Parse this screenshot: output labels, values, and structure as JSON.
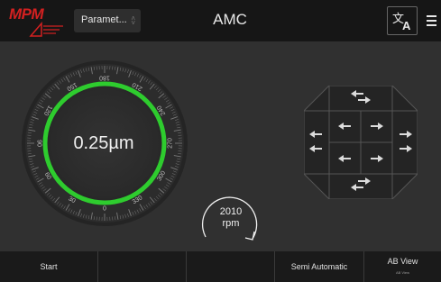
{
  "header": {
    "logo_text": "MPM",
    "parameter_select": "Paramet...",
    "title": "AMC",
    "translate_icon": "translate-icon",
    "menu_icon": "hamburger-menu-icon"
  },
  "gauge": {
    "readout": "0.25µm",
    "dial_labels": [
      "0",
      "30",
      "60",
      "90",
      "120",
      "150",
      "180",
      "210",
      "240",
      "270",
      "300",
      "330"
    ],
    "ring_color": "#2ecc2e"
  },
  "spindle": {
    "value": "2010",
    "unit": "rpm",
    "icon": "clockwise-arrow-icon"
  },
  "dpad": {
    "icons": [
      "arrow-left-icon",
      "arrow-right-icon",
      "arrow-up-icon",
      "arrow-down-icon"
    ]
  },
  "bottom_bar": {
    "buttons": [
      {
        "label": "Start"
      },
      {
        "label": ""
      },
      {
        "label": ""
      },
      {
        "label": "Semi Automatic"
      },
      {
        "label": "AB View",
        "sublabel": "AB View"
      }
    ]
  }
}
